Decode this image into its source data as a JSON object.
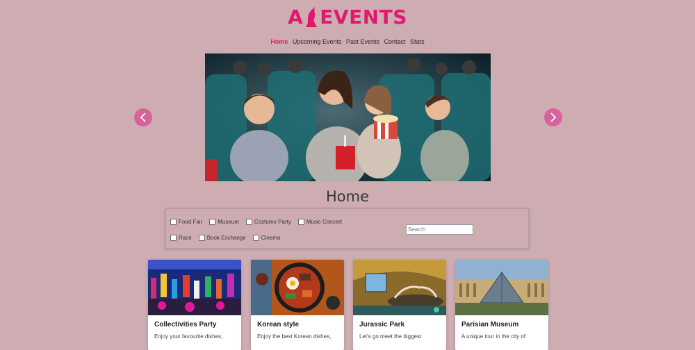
{
  "brand": {
    "name_a": "A",
    "name_rest": "EVENTS"
  },
  "nav": {
    "items": [
      "Home",
      "Upcoming Events",
      "Past Events",
      "Contact",
      "Stats"
    ]
  },
  "page_title": "Home",
  "filters": {
    "row1": [
      "Food Fair",
      "Museum",
      "Costume Party",
      "Music Concert"
    ],
    "row2": [
      "Race",
      "Book Exchange",
      "Cinema"
    ],
    "search_placeholder": "Search"
  },
  "cards": [
    {
      "title": "Collectivities Party",
      "desc": "Enjoy your favourite dishes,"
    },
    {
      "title": "Korean style",
      "desc": "Enjoy the best Korean dishes,"
    },
    {
      "title": "Jurassic Park",
      "desc": "Let's go meet the biggest"
    },
    {
      "title": "Parisian Museum",
      "desc": "A unique tour in the city of"
    }
  ],
  "colors": {
    "accent": "#e0196e",
    "background": "#cdadb2",
    "arrow": "#d6639c"
  }
}
